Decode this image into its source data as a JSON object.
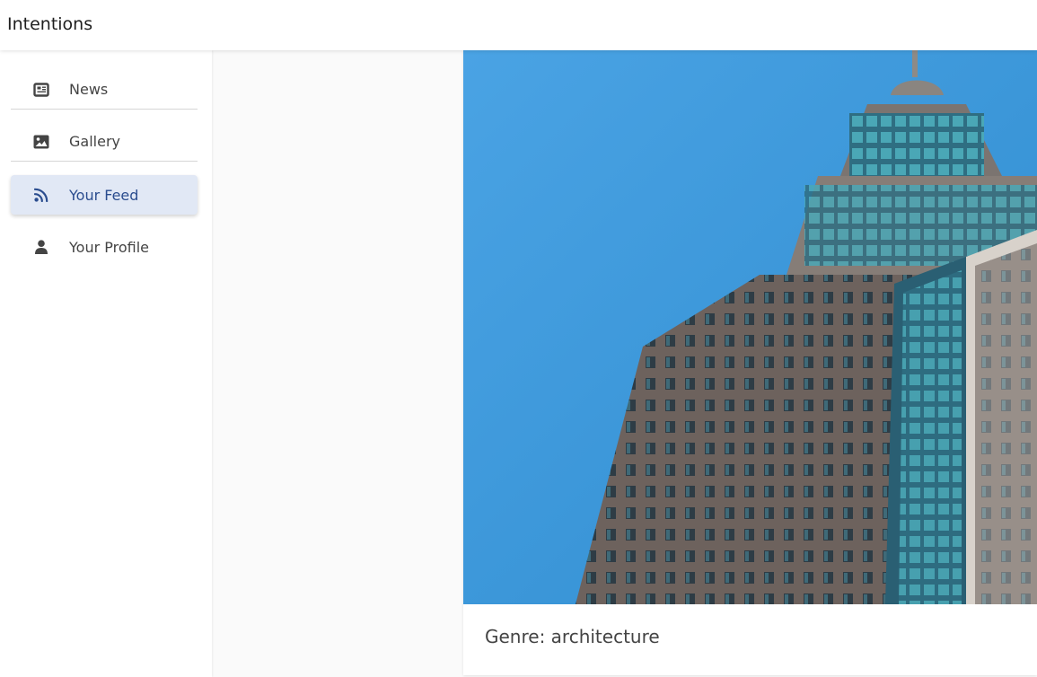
{
  "app": {
    "title": "Intentions"
  },
  "sidebar": {
    "items": [
      {
        "label": "News",
        "icon": "newspaper-icon",
        "active": false
      },
      {
        "label": "Gallery",
        "icon": "image-icon",
        "active": false
      },
      {
        "label": "Your Feed",
        "icon": "rss-icon",
        "active": true
      },
      {
        "label": "Your Profile",
        "icon": "user-icon",
        "active": false
      }
    ]
  },
  "feed": {
    "card": {
      "image": "skyscraper-photo",
      "genre_text": "Genre: architecture"
    }
  },
  "colors": {
    "accent": "#2b4d8f",
    "active_bg": "#e1e8f5",
    "sky": "#3a9ad9"
  }
}
